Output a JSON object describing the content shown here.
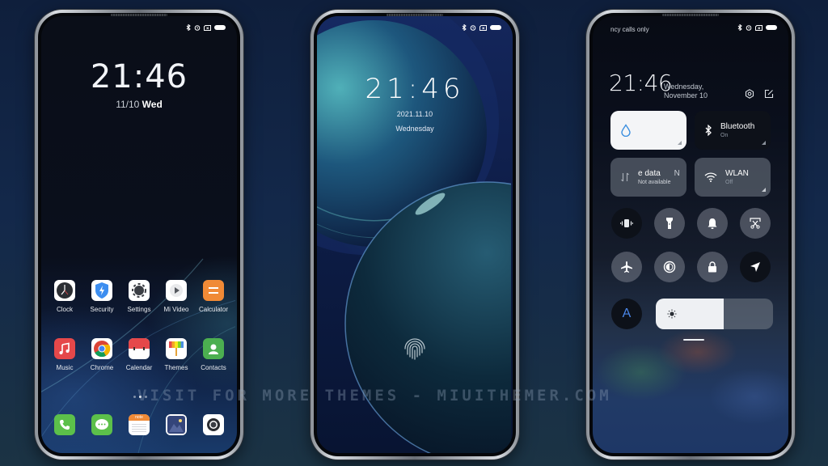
{
  "phones": {
    "home": {
      "status_icons": [
        "bluetooth-icon",
        "alarm-icon",
        "no-sim-icon",
        "battery-icon"
      ],
      "clock": "21:46",
      "date": "11/10",
      "weekday": "Wed",
      "apps_row1": [
        {
          "label": "Clock",
          "icon": "clock-icon"
        },
        {
          "label": "Security",
          "icon": "security-shield-icon"
        },
        {
          "label": "Settings",
          "icon": "settings-gear-icon"
        },
        {
          "label": "Mi Video",
          "icon": "play-video-icon"
        },
        {
          "label": "Calculator",
          "icon": "calculator-icon"
        }
      ],
      "apps_row2": [
        {
          "label": "Music",
          "icon": "music-note-icon"
        },
        {
          "label": "Chrome",
          "icon": "chrome-icon"
        },
        {
          "label": "Calendar",
          "icon": "calendar-icon"
        },
        {
          "label": "Themes",
          "icon": "themes-brush-icon"
        },
        {
          "label": "Contacts",
          "icon": "contacts-icon"
        }
      ],
      "page_indicator": {
        "pages": 3,
        "active": 2
      },
      "dock": [
        {
          "name": "Phone",
          "icon": "phone-icon"
        },
        {
          "name": "Messages",
          "icon": "messages-icon"
        },
        {
          "name": "Notes",
          "icon": "notes-icon",
          "badge_text": "note"
        },
        {
          "name": "Gallery",
          "icon": "gallery-icon"
        },
        {
          "name": "Camera",
          "icon": "camera-icon"
        }
      ]
    },
    "lock": {
      "status_icons": [
        "bluetooth-icon",
        "alarm-icon",
        "no-sim-icon",
        "battery-icon"
      ],
      "clock": "21:46",
      "date": "2021.11.10",
      "weekday": "Wednesday",
      "fingerprint_icon": "fingerprint-icon"
    },
    "control_center": {
      "carrier_text": "ncy calls only",
      "status_icons": [
        "bluetooth-icon",
        "alarm-icon",
        "no-sim-icon",
        "battery-icon"
      ],
      "clock": "21:46",
      "date_line1": "Wednesday,",
      "date_line2": "November 10",
      "header_actions": [
        "settings-icon",
        "edit-icon"
      ],
      "tiles": [
        {
          "id": "data-saver",
          "title": "",
          "subtitle": "",
          "icon": "water-drop-icon",
          "active": true
        },
        {
          "id": "bluetooth",
          "title": "Bluetooth",
          "subtitle": "On",
          "icon": "bluetooth-icon",
          "active": false
        },
        {
          "id": "mobile-data",
          "title": "e data",
          "title_suffix": "N",
          "subtitle": "Not available",
          "icon": "mobile-data-icon",
          "active": false
        },
        {
          "id": "wlan",
          "title": "WLAN",
          "subtitle": "Off",
          "icon": "wifi-icon",
          "active": false
        }
      ],
      "toggles_row1": [
        {
          "id": "vibrate",
          "icon": "vibrate-icon",
          "on": false
        },
        {
          "id": "flashlight",
          "icon": "flashlight-icon",
          "on": true
        },
        {
          "id": "sound",
          "icon": "bell-icon",
          "on": true
        },
        {
          "id": "screenshot",
          "icon": "screenshot-scissors-icon",
          "on": true
        }
      ],
      "toggles_row2": [
        {
          "id": "airplane",
          "icon": "airplane-icon",
          "on": true
        },
        {
          "id": "reading-mode",
          "icon": "reading-mode-icon",
          "on": true
        },
        {
          "id": "lock-screen",
          "icon": "lock-icon",
          "on": true
        },
        {
          "id": "location",
          "icon": "location-arrow-icon",
          "on": false
        }
      ],
      "auto_brightness_label": "A",
      "brightness_fraction": 0.58
    }
  },
  "watermark": "VISIT FOR MORE THEMES - MIUITHEMER.COM"
}
